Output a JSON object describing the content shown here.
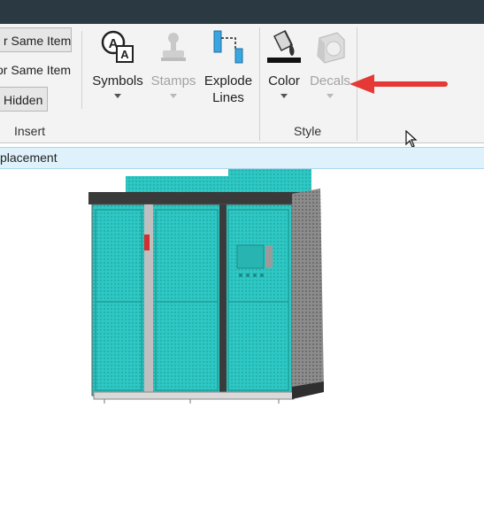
{
  "ribbon": {
    "insert_group": {
      "label": "Insert",
      "same_item_btn": "r Same Item",
      "or_same_item_btn": "or Same Item",
      "hidden_btn": "Hidden"
    },
    "symbols": {
      "label": "Symbols",
      "icon": "symbols-icon"
    },
    "stamps": {
      "label": "Stamps",
      "icon": "stamp-icon",
      "enabled": false
    },
    "explode": {
      "label_line1": "Explode",
      "label_line2": "Lines",
      "icon": "explode-lines-icon"
    },
    "style_group": {
      "label": "Style",
      "color": {
        "label": "Color",
        "icon": "paint-bucket-icon"
      },
      "decals": {
        "label": "Decals",
        "icon": "decal-icon",
        "enabled": false
      }
    }
  },
  "breadcrumb": {
    "text": "placement"
  },
  "colors": {
    "accent_cyan": "#2ec8c4",
    "highlight_arrow": "#e53935"
  }
}
